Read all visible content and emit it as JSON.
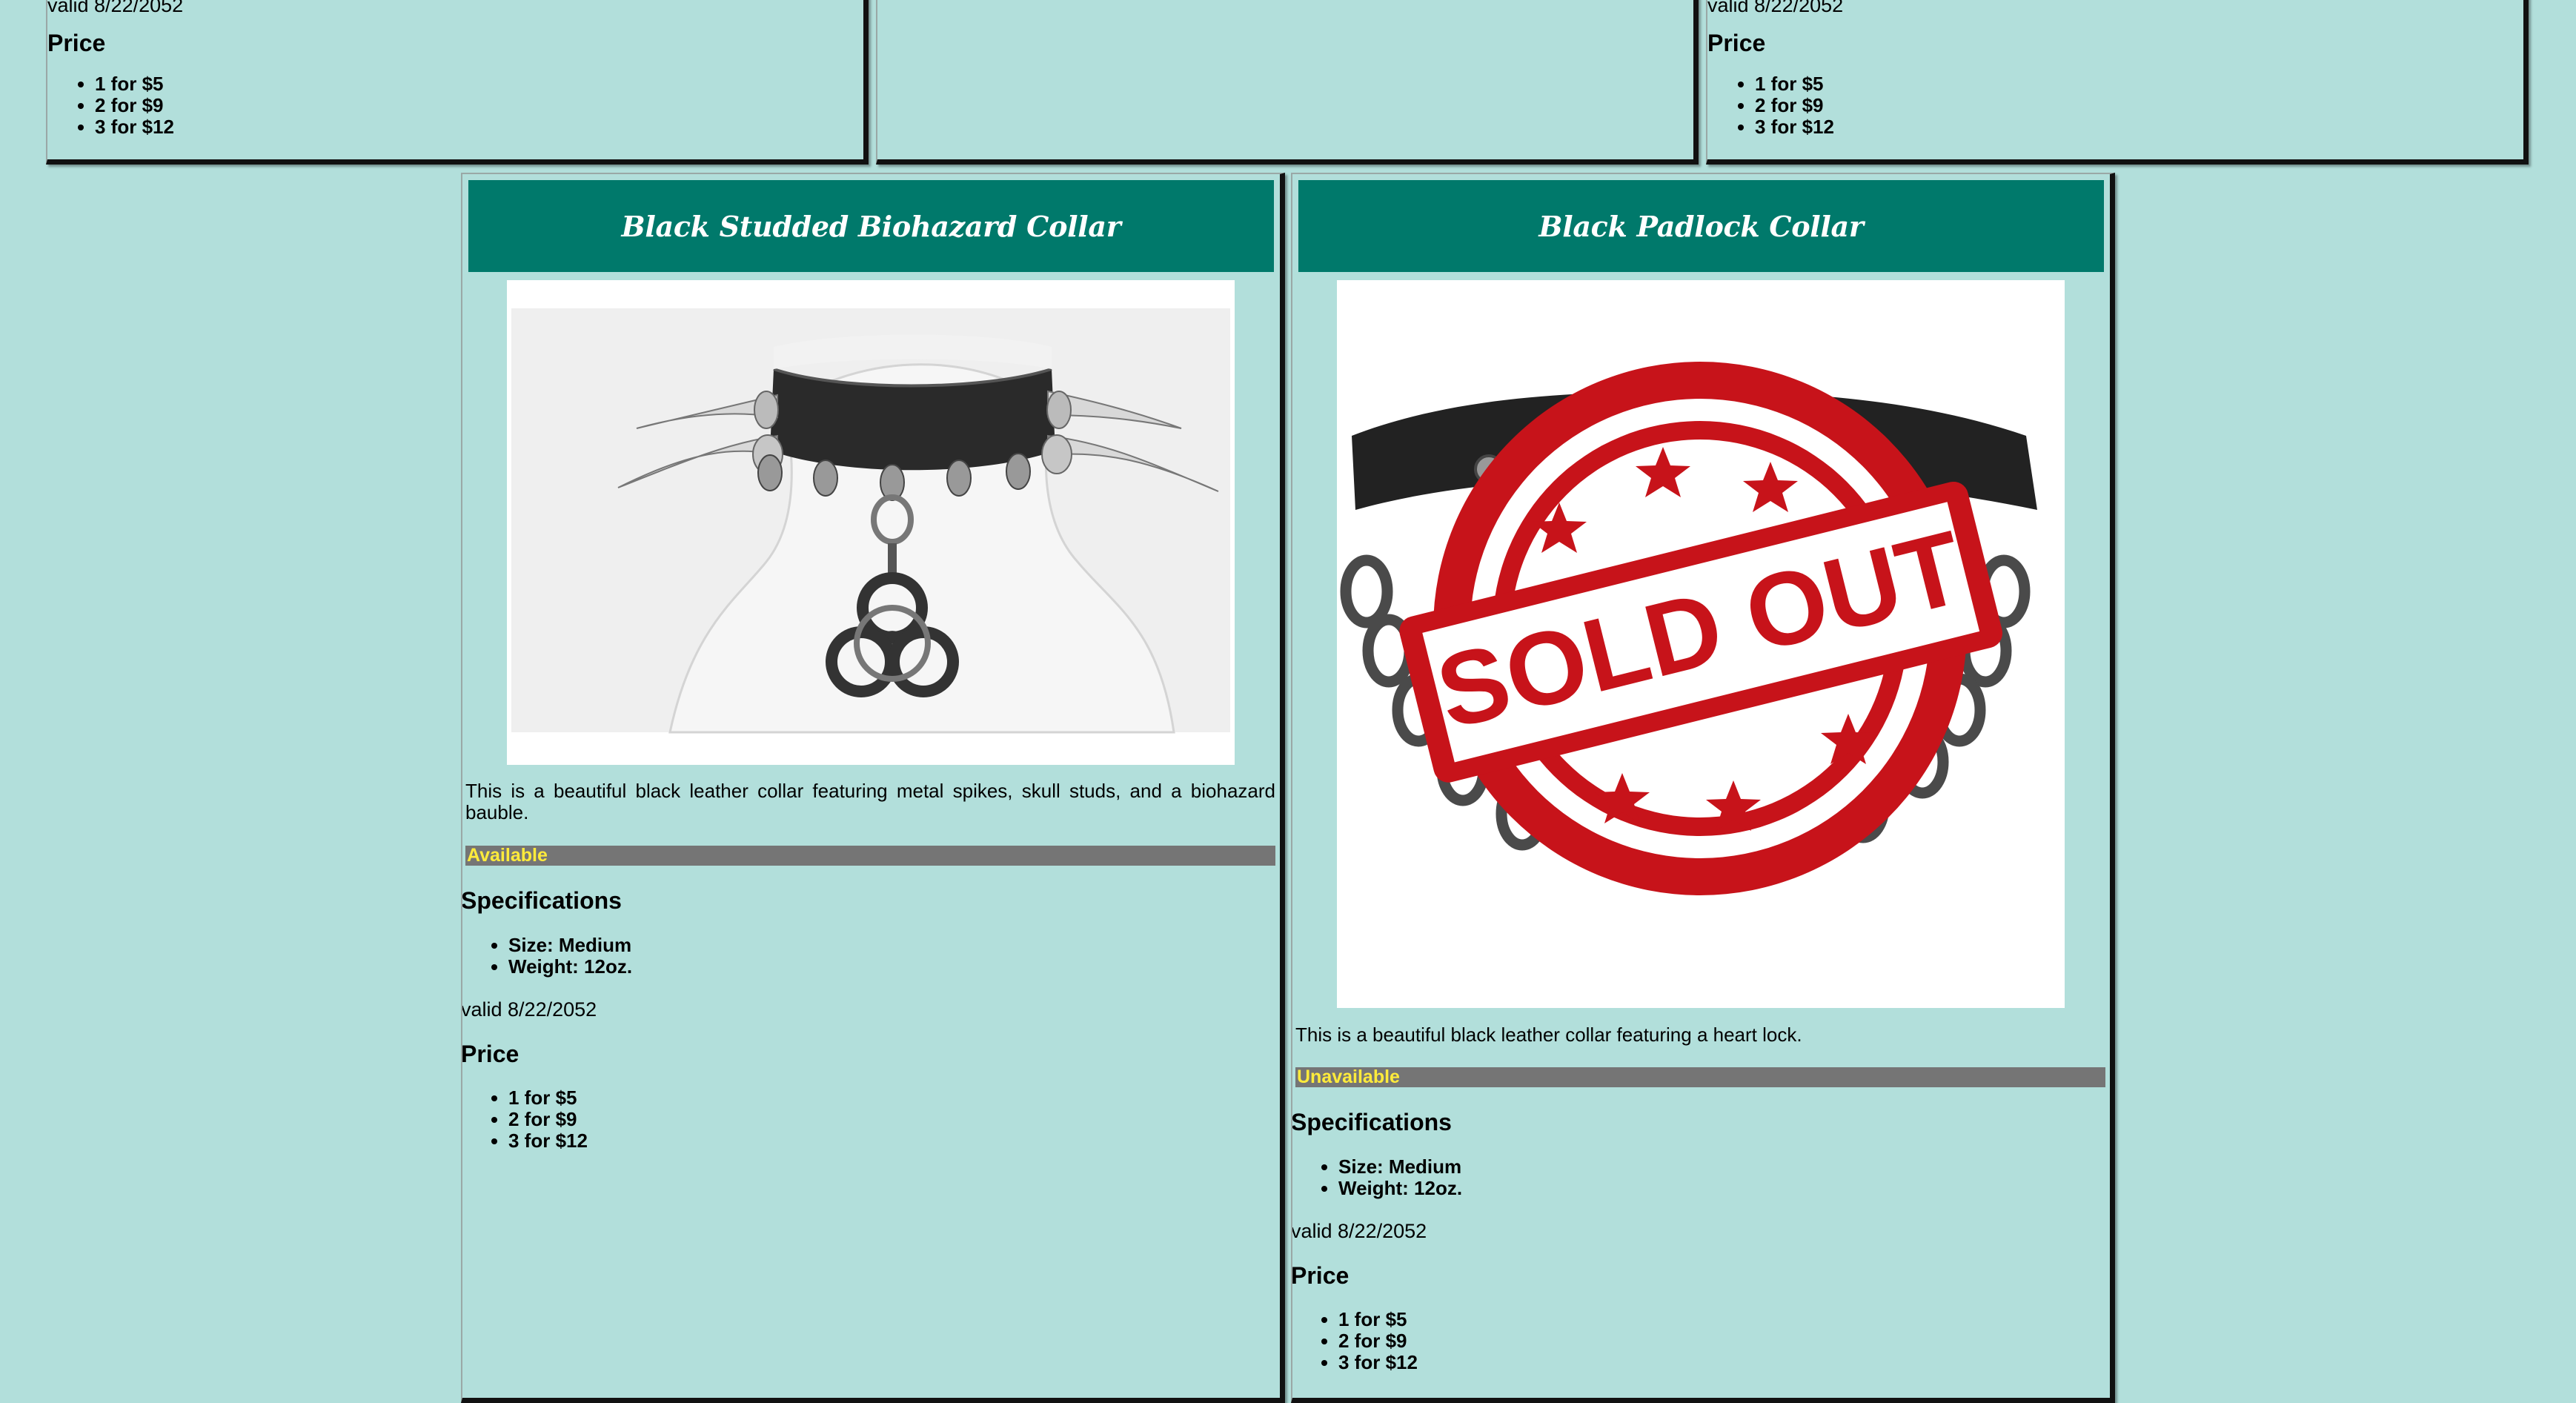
{
  "page": {
    "background": "#b2dfdb",
    "header_color": "#00796b",
    "status_color": "#757575",
    "status_text_color": "#ffeb3b"
  },
  "top_cards": [
    {
      "valid_text": "valid 8/22/2052",
      "price_heading": "Price",
      "prices": [
        "1 for $5",
        "2 for $9",
        "3 for $12"
      ]
    },
    {
      "valid_text": "",
      "price_heading": "",
      "prices": []
    },
    {
      "valid_text": "valid 8/22/2052",
      "price_heading": "Price",
      "prices": [
        "1 for $5",
        "2 for $9",
        "3 for $12"
      ]
    }
  ],
  "products": [
    {
      "title": "Black Studded Biohazard Collar",
      "image_icon": "biohazard-collar-image",
      "description": "This is a beautiful black leather collar featuring metal spikes, skull studs, and a biohazard bauble.",
      "status": "Available",
      "specs_heading": "Specifications",
      "specs": [
        "Size: Medium",
        "Weight: 12oz."
      ],
      "valid_text": "valid 8/22/2052",
      "price_heading": "Price",
      "prices": [
        "1 for $5",
        "2 for $9",
        "3 for $12"
      ]
    },
    {
      "title": "Black Padlock Collar",
      "image_icon": "padlock-collar-image",
      "overlay_stamp": "SOLD OUT",
      "description": "This is a beautiful black leather collar featuring a heart lock.",
      "status": "Unavailable",
      "specs_heading": "Specifications",
      "specs": [
        "Size: Medium",
        "Weight: 12oz."
      ],
      "valid_text": "valid 8/22/2052",
      "price_heading": "Price",
      "prices": [
        "1 for $5",
        "2 for $9",
        "3 for $12"
      ]
    }
  ]
}
